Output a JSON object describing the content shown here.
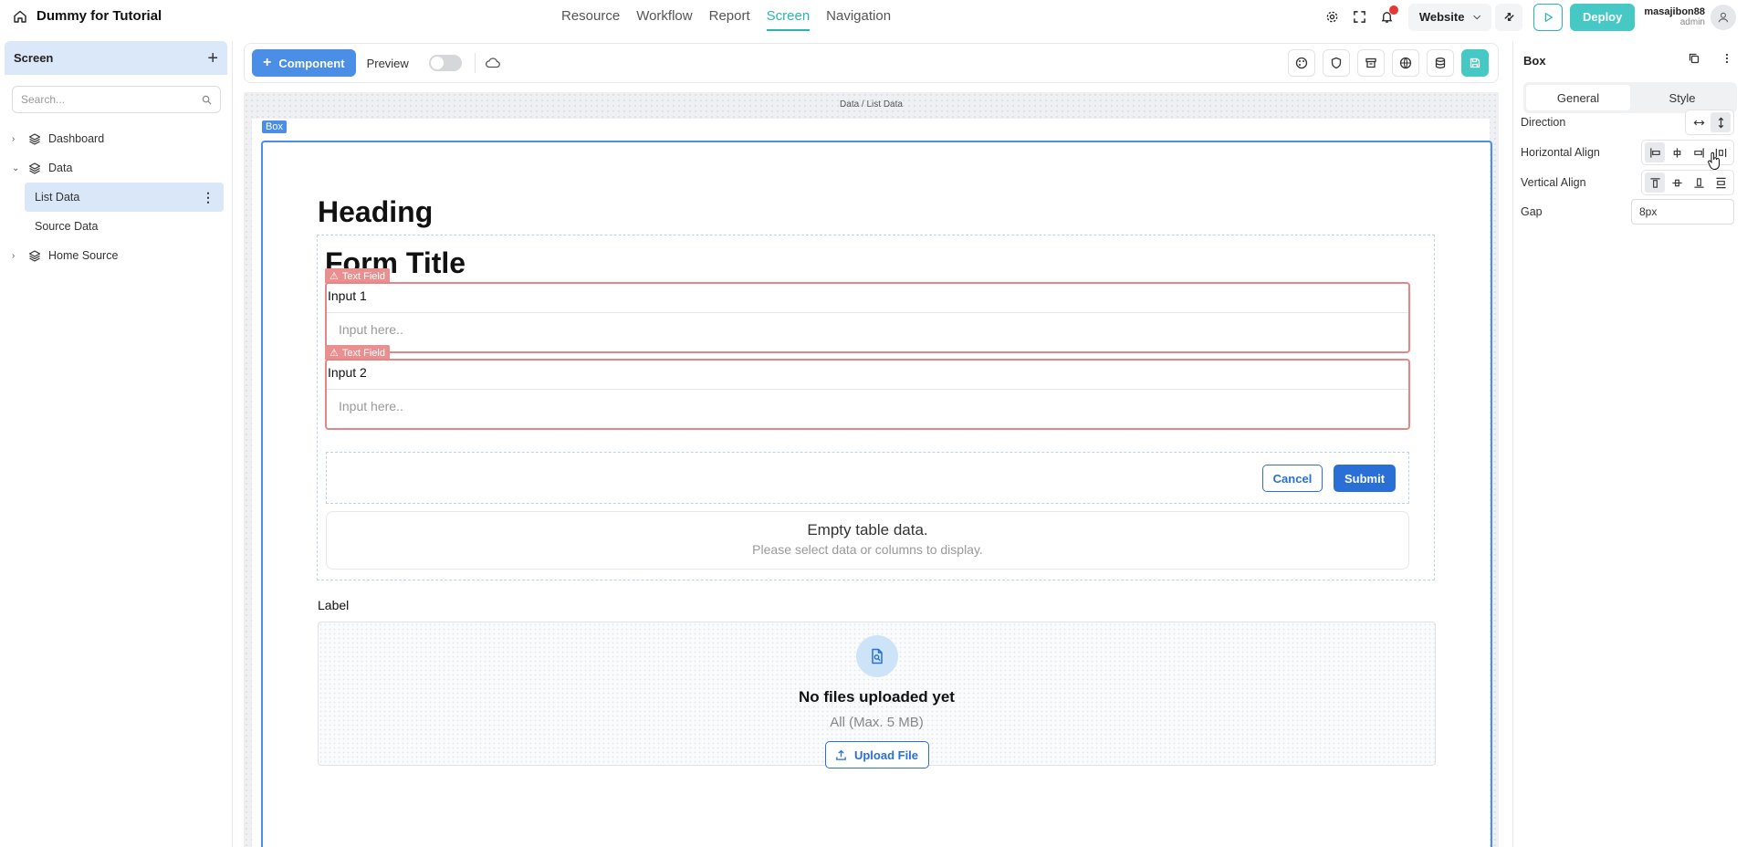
{
  "app": {
    "title": "Dummy for Tutorial"
  },
  "nav": {
    "items": [
      "Resource",
      "Workflow",
      "Report",
      "Screen",
      "Navigation"
    ],
    "active": "Screen"
  },
  "topbar": {
    "environment": "Website",
    "deploy_label": "Deploy",
    "user_name": "masajibon88",
    "user_role": "admin"
  },
  "sidebar": {
    "title": "Screen",
    "search_placeholder": "Search...",
    "items": [
      {
        "label": "Dashboard",
        "expanded": false
      },
      {
        "label": "Data",
        "expanded": true
      },
      {
        "label": "List Data",
        "selected": true
      },
      {
        "label": "Source Data"
      },
      {
        "label": "Home Source",
        "expanded": false
      }
    ]
  },
  "toolbar": {
    "component_label": "Component",
    "preview_label": "Preview",
    "preview_on": false
  },
  "canvas": {
    "breadcrumb": "Data / List Data",
    "box_tag": "Box",
    "heading": "Heading",
    "form_title": "Form Title",
    "textfield_tag": "Text Field",
    "fields": [
      {
        "label": "Input 1",
        "placeholder": "Input here.."
      },
      {
        "label": "Input 2",
        "placeholder": "Input here.."
      }
    ],
    "cancel_label": "Cancel",
    "submit_label": "Submit",
    "empty_title": "Empty table data.",
    "empty_sub": "Please select data or columns to display.",
    "upload_label": "Label",
    "upload_title": "No files uploaded yet",
    "upload_sub": "All (Max. 5 MB)",
    "upload_button": "Upload File"
  },
  "panel": {
    "title": "Box",
    "tabs": [
      "General",
      "Style"
    ],
    "active_tab": "General",
    "direction_label": "Direction",
    "halign_label": "Horizontal Align",
    "valign_label": "Vertical Align",
    "gap_label": "Gap",
    "gap_value": "8px"
  },
  "colors": {
    "accent_teal": "#46c9c4",
    "primary_blue": "#2a6fd6",
    "error_red": "#e38686"
  }
}
